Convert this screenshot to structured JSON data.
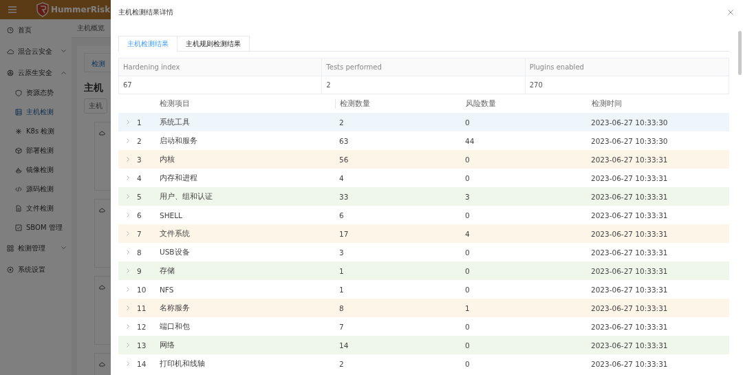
{
  "app": {
    "logo": "HummerRisk",
    "breadcrumb": "主机概览",
    "tab": "检测",
    "heading": "主机",
    "button": "主机"
  },
  "sidebar": {
    "items": [
      {
        "label": "首页",
        "selected": false
      },
      {
        "label": "混合云安全",
        "expanded": false,
        "selected": false
      },
      {
        "label": "云原生安全",
        "expanded": true,
        "selected": false,
        "children": [
          {
            "label": "资源态势",
            "selected": false
          },
          {
            "label": "主机检测",
            "selected": true
          },
          {
            "label": "K8s 检测",
            "selected": false
          },
          {
            "label": "部署检测",
            "selected": false
          },
          {
            "label": "镜像检测",
            "selected": false
          },
          {
            "label": "源码检测",
            "selected": false
          },
          {
            "label": "文件检测",
            "selected": false
          },
          {
            "label": "SBOM 管理",
            "selected": false
          }
        ]
      },
      {
        "label": "检测管理",
        "expanded": false,
        "selected": false
      },
      {
        "label": "系统设置",
        "selected": false
      }
    ]
  },
  "drawer": {
    "title": "主机检测结果详情",
    "tabs": [
      {
        "label": "主机检测结果",
        "selected": true
      },
      {
        "label": "主机规则检测结果",
        "selected": false
      }
    ],
    "summary": {
      "columns": [
        "Hardening index",
        "Tests performed",
        "Plugins enabled"
      ],
      "values": [
        "67",
        "2",
        "270"
      ]
    },
    "table": {
      "columns": [
        "检测项目",
        "检测数量",
        "风险数量",
        "检测时间"
      ],
      "rows": [
        {
          "index": "1",
          "item": "系统工具",
          "count": "2",
          "risk": "0",
          "time": "2023-06-27 10:33:30",
          "color": "#eef5fb"
        },
        {
          "index": "2",
          "item": "启动和服务",
          "count": "63",
          "risk": "44",
          "time": "2023-06-27 10:33:30",
          "color": "#ffffff"
        },
        {
          "index": "3",
          "item": "内核",
          "count": "56",
          "risk": "0",
          "time": "2023-06-27 10:33:31",
          "color": "#fdf5e8"
        },
        {
          "index": "4",
          "item": "内存和进程",
          "count": "4",
          "risk": "0",
          "time": "2023-06-27 10:33:31",
          "color": "#ffffff"
        },
        {
          "index": "5",
          "item": "用户、组和认证",
          "count": "33",
          "risk": "3",
          "time": "2023-06-27 10:33:31",
          "color": "#eff6ea"
        },
        {
          "index": "6",
          "item": "SHELL",
          "count": "6",
          "risk": "0",
          "time": "2023-06-27 10:33:31",
          "color": "#ffffff"
        },
        {
          "index": "7",
          "item": "文件系统",
          "count": "17",
          "risk": "4",
          "time": "2023-06-27 10:33:31",
          "color": "#fdf5e8"
        },
        {
          "index": "8",
          "item": "USB设备",
          "count": "3",
          "risk": "0",
          "time": "2023-06-27 10:33:31",
          "color": "#ffffff"
        },
        {
          "index": "9",
          "item": "存储",
          "count": "1",
          "risk": "0",
          "time": "2023-06-27 10:33:31",
          "color": "#eff6ea"
        },
        {
          "index": "10",
          "item": "NFS",
          "count": "1",
          "risk": "0",
          "time": "2023-06-27 10:33:31",
          "color": "#ffffff"
        },
        {
          "index": "11",
          "item": "名称服务",
          "count": "8",
          "risk": "1",
          "time": "2023-06-27 10:33:31",
          "color": "#fdf5e8"
        },
        {
          "index": "12",
          "item": "端口和包",
          "count": "7",
          "risk": "0",
          "time": "2023-06-27 10:33:31",
          "color": "#ffffff"
        },
        {
          "index": "13",
          "item": "网络",
          "count": "14",
          "risk": "0",
          "time": "2023-06-27 10:33:31",
          "color": "#eff6ea"
        },
        {
          "index": "14",
          "item": "打印机和线轴",
          "count": "2",
          "risk": "0",
          "time": "2023-06-27 10:33:31",
          "color": "#ffffff"
        }
      ]
    }
  }
}
